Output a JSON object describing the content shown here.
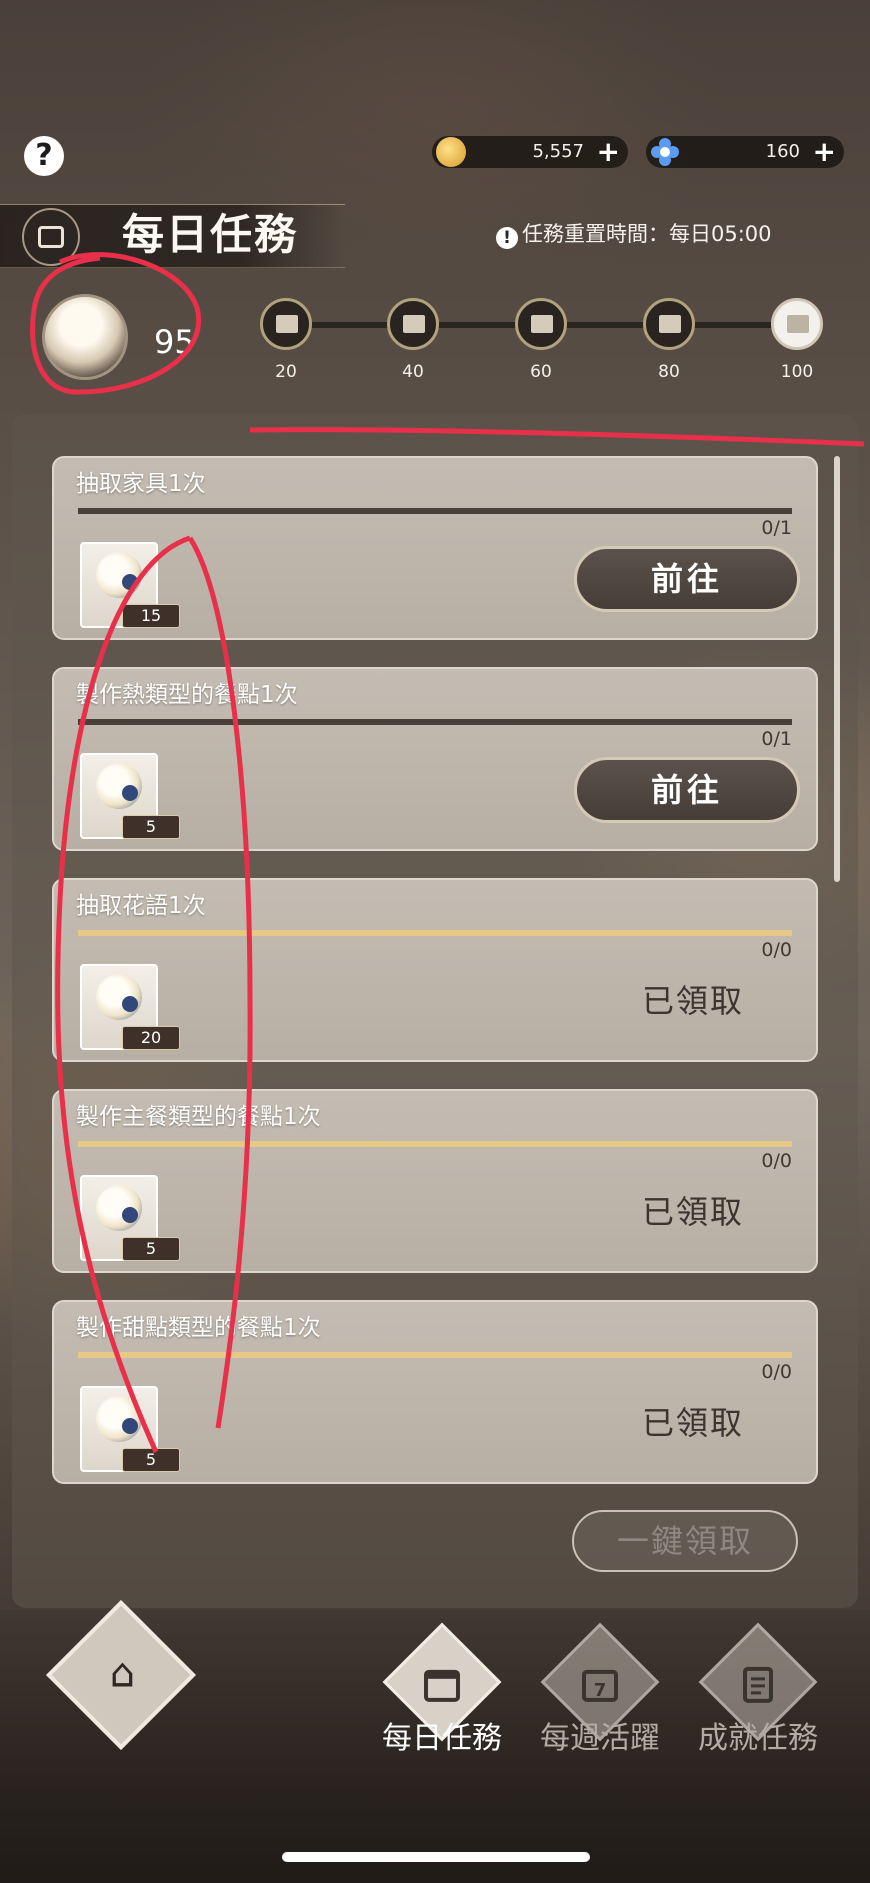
{
  "topbar": {
    "help_label": "?",
    "gold": {
      "value": "5,557",
      "plus": "+",
      "icon": "gold-coin-icon",
      "color": "#e6b33c"
    },
    "gems": {
      "value": "160",
      "plus": "+",
      "icon": "blue-flower-icon",
      "color": "#3d7fe0"
    }
  },
  "header": {
    "title": "每日任務",
    "icon": "calendar-check-icon",
    "reset_notice": "任務重置時間：每日05:00",
    "reset_icon": "exclamation-icon"
  },
  "progress": {
    "points": "95",
    "milestones": [
      {
        "label": "20",
        "icon": "chest-icon"
      },
      {
        "label": "40",
        "icon": "chest-icon"
      },
      {
        "label": "60",
        "icon": "chest-icon"
      },
      {
        "label": "80",
        "icon": "chest-icon"
      },
      {
        "label": "100",
        "icon": "gift-icon"
      }
    ]
  },
  "tasks": [
    {
      "title": "抽取家具1次",
      "progress": "0/1",
      "fill": 0,
      "reward_qty": "15",
      "action": "前往",
      "state": "go"
    },
    {
      "title": "製作熱類型的餐點1次",
      "progress": "0/1",
      "fill": 0,
      "reward_qty": "5",
      "action": "前往",
      "state": "go"
    },
    {
      "title": "抽取花語1次",
      "progress": "0/0",
      "fill": 1,
      "reward_qty": "20",
      "action": "已領取",
      "state": "claimed"
    },
    {
      "title": "製作主餐類型的餐點1次",
      "progress": "0/0",
      "fill": 1,
      "reward_qty": "5",
      "action": "已領取",
      "state": "claimed"
    },
    {
      "title": "製作甜點類型的餐點1次",
      "progress": "0/0",
      "fill": 1,
      "reward_qty": "5",
      "action": "已領取",
      "state": "claimed"
    }
  ],
  "one_click_claim": "一鍵領取",
  "nav": {
    "home_icon": "home-icon",
    "tabs": [
      {
        "label": "每日任務",
        "icon": "calendar-check-icon",
        "active": true
      },
      {
        "label": "每週活躍",
        "icon": "calendar-7-icon",
        "active": false
      },
      {
        "label": "成就任務",
        "icon": "notebook-icon",
        "active": false
      }
    ]
  },
  "colors": {
    "accent_gold": "#e6c987",
    "annotation_red": "#e8304a"
  }
}
